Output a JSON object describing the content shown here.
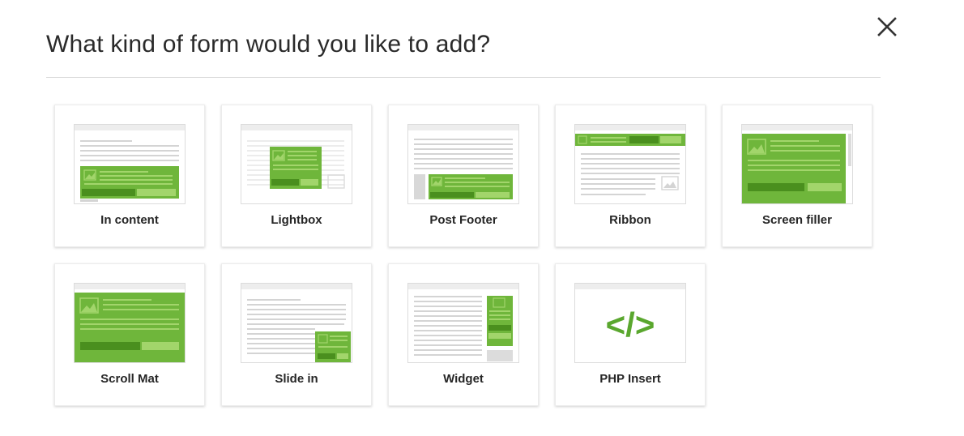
{
  "modal": {
    "title": "What kind of form would you like to add?",
    "close_icon": "close-icon"
  },
  "colors": {
    "accent": "#6fb63b",
    "accent_dark": "#4a8f1e",
    "accent_light": "#a2d56b"
  },
  "form_types": [
    {
      "key": "in-content",
      "label": "In content"
    },
    {
      "key": "lightbox",
      "label": "Lightbox"
    },
    {
      "key": "post-footer",
      "label": "Post Footer"
    },
    {
      "key": "ribbon",
      "label": "Ribbon"
    },
    {
      "key": "screen-filler",
      "label": "Screen filler"
    },
    {
      "key": "scroll-mat",
      "label": "Scroll Mat"
    },
    {
      "key": "slide-in",
      "label": "Slide in"
    },
    {
      "key": "widget",
      "label": "Widget"
    },
    {
      "key": "php-insert",
      "label": "PHP Insert",
      "icon_text": "</>"
    }
  ]
}
